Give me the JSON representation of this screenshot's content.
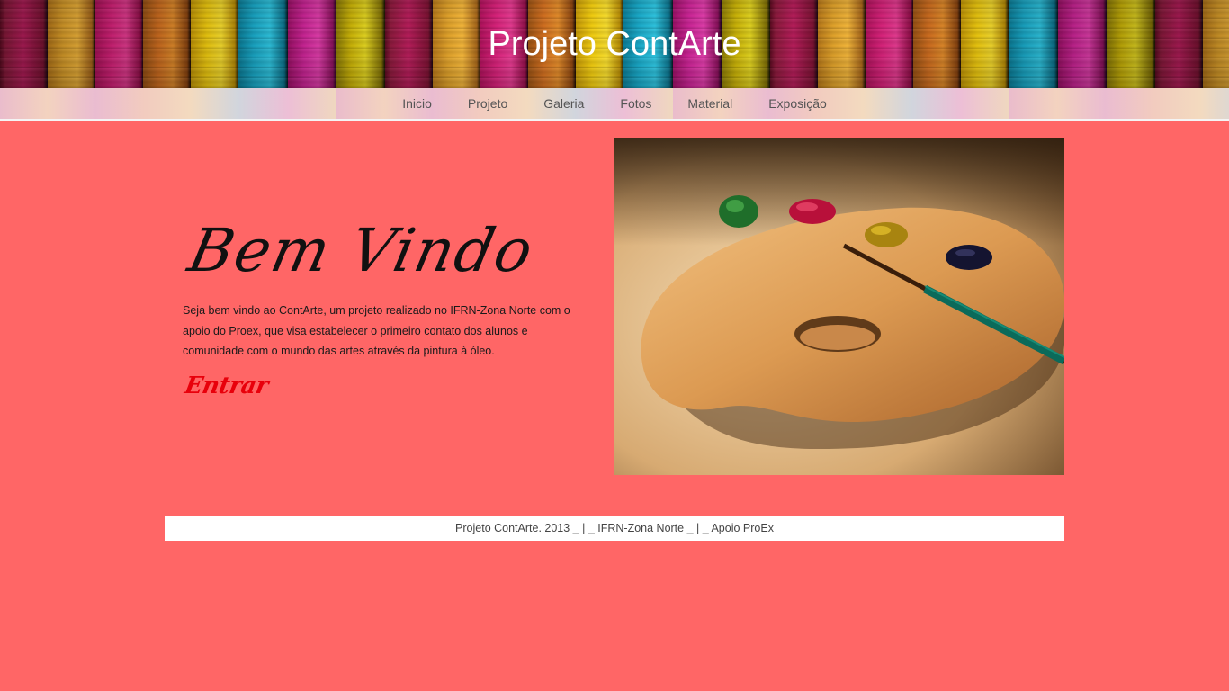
{
  "header": {
    "title": "Projeto ContArte"
  },
  "nav": {
    "items": [
      {
        "label": "Inicio"
      },
      {
        "label": "Projeto"
      },
      {
        "label": "Galeria"
      },
      {
        "label": "Fotos"
      },
      {
        "label": "Material"
      },
      {
        "label": "Exposição"
      }
    ]
  },
  "main": {
    "heading": "Bem Vindo",
    "text": "Seja bem vindo ao ContArte, um projeto realizado no IFRN-Zona Norte com o apoio do Proex, que visa estabelecer o primeiro contato dos alunos e comunidade com o mundo das artes através da pintura à óleo.",
    "enter_link": "Entrar"
  },
  "footer": {
    "text": "Projeto ContArte. 2013 _ | _ IFRN-Zona Norte _ | _ Apoio ProEx"
  },
  "colors": {
    "background": "#ff6666",
    "enter_link": "#e8000b",
    "title": "#ffffff"
  }
}
